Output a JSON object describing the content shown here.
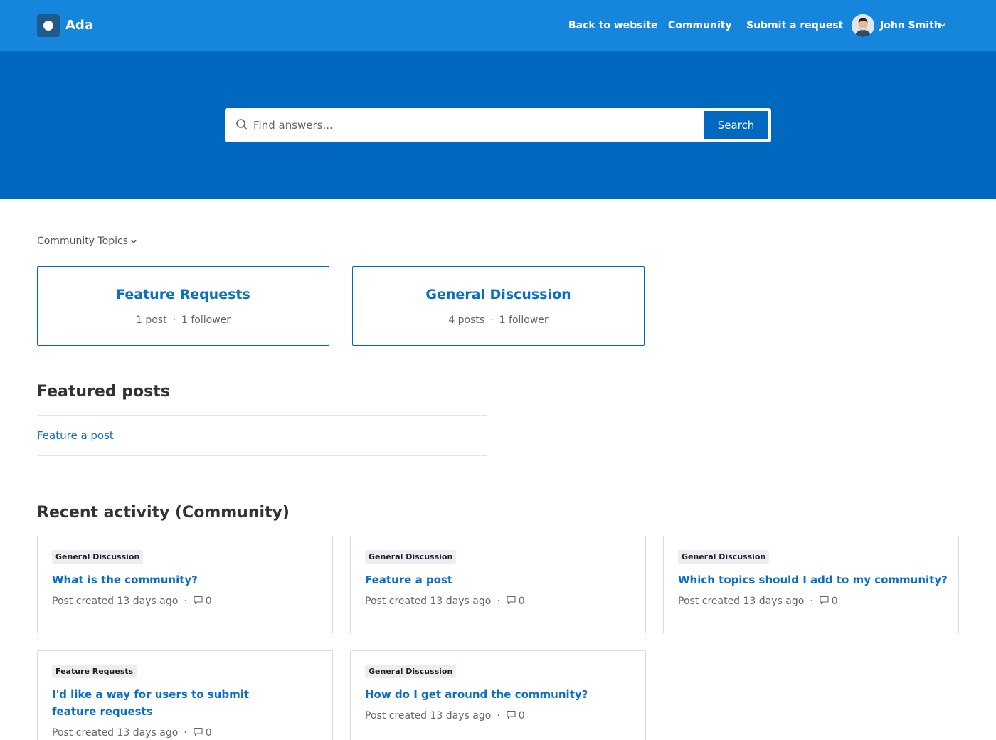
{
  "header": {
    "brand": "Ada",
    "nav": [
      "Back to website",
      "Community",
      "Submit a request"
    ],
    "user_name": "John Smith",
    "colors": {
      "bar": "#1686dc",
      "hero": "#0068bf",
      "link": "#0b6fc3"
    }
  },
  "search": {
    "placeholder": "Find answers...",
    "button_label": "Search"
  },
  "topics": {
    "toggle_label": "Community Topics",
    "cards": [
      {
        "title": "Feature Requests",
        "posts": "1 post",
        "followers": "1 follower"
      },
      {
        "title": "General Discussion",
        "posts": "4 posts",
        "followers": "1 follower"
      }
    ]
  },
  "featured": {
    "heading": "Featured posts",
    "link": "Feature a post"
  },
  "recent": {
    "heading": "Recent activity (Community)",
    "items": [
      {
        "topic": "General Discussion",
        "title": "What is the community?",
        "meta": "Post created 13 days ago",
        "comments": "0"
      },
      {
        "topic": "General Discussion",
        "title": "Feature a post",
        "meta": "Post created 13 days ago",
        "comments": "0"
      },
      {
        "topic": "General Discussion",
        "title": "Which topics should I add to my community?",
        "meta": "Post created 13 days ago",
        "comments": "0"
      },
      {
        "topic": "Feature Requests",
        "title": "I'd like a way for users to submit feature requests",
        "meta": "Post created 13 days ago",
        "comments": "0"
      },
      {
        "topic": "General Discussion",
        "title": "How do I get around the community?",
        "meta": "Post created 13 days ago",
        "comments": "0"
      }
    ]
  }
}
